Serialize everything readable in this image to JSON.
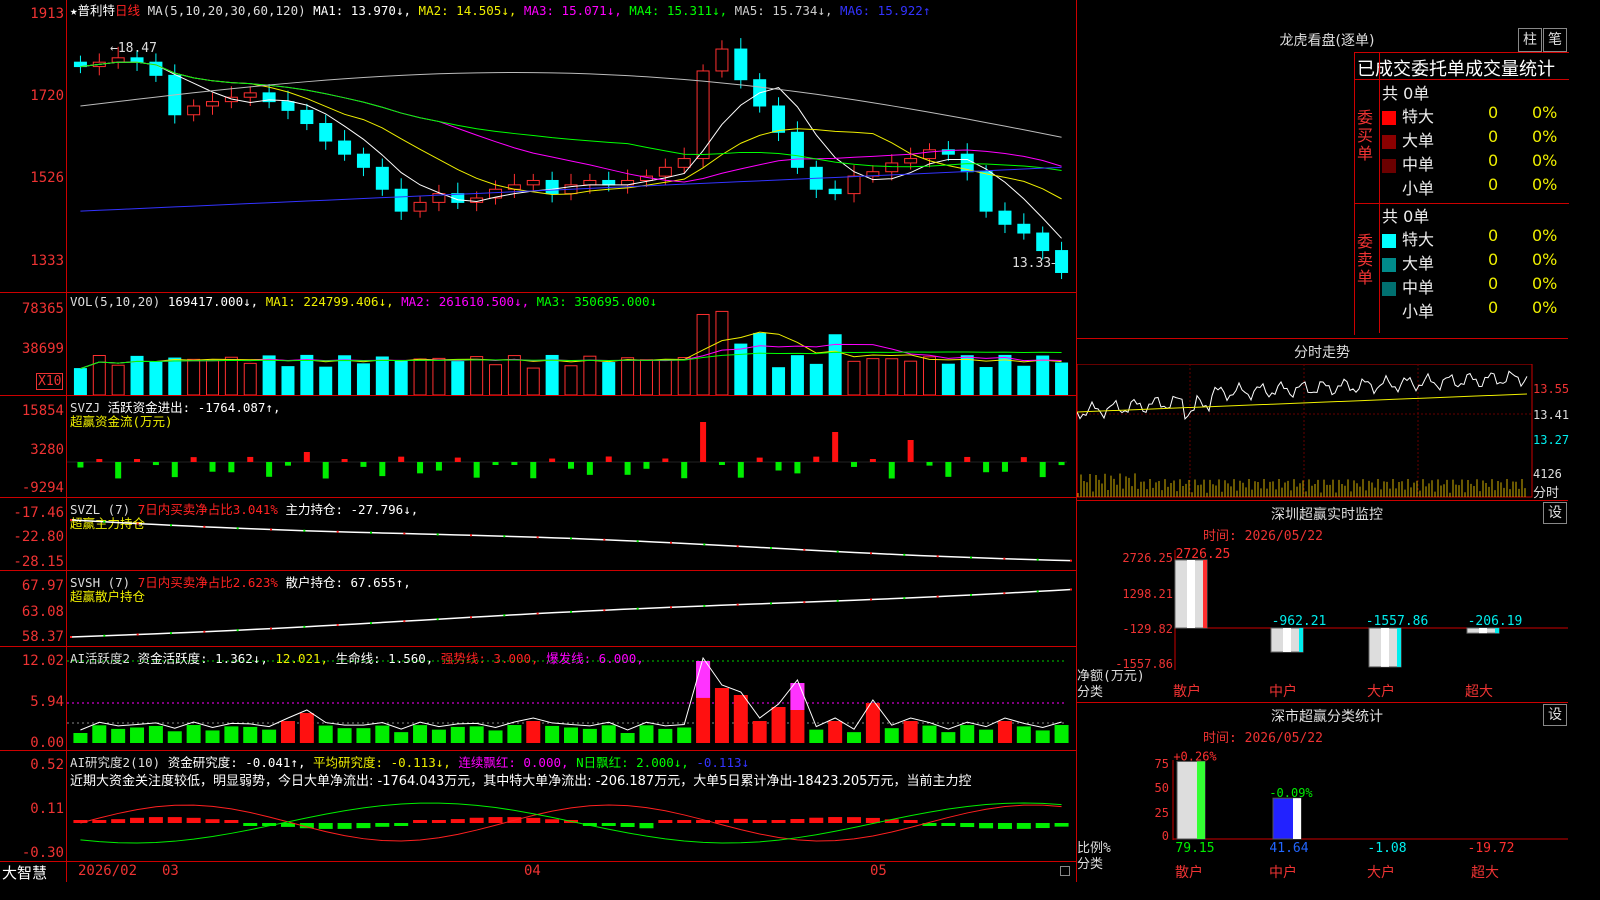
{
  "app": {
    "name": "大智慧"
  },
  "chart_header": {
    "star": "★",
    "stock": "普利特",
    "period": "日线",
    "ma_def": "MA(5,10,20,30,60,120)",
    "ma1": "MA1: 13.970↓,",
    "ma2": "MA2: 14.505↓,",
    "ma3": "MA3: 15.071↓,",
    "ma4": "MA4: 15.311↓,",
    "ma5": "MA5: 15.734↓,",
    "ma6": "MA6: 15.922↑"
  },
  "price_axis": [
    "1913",
    "1720",
    "1526",
    "1333"
  ],
  "price_annotations": {
    "high": "←18.47",
    "low": "13.33→"
  },
  "vol_header": {
    "def": "VOL(5,10,20)",
    "vol": "169417.000↓,",
    "ma1": "MA1: 224799.406↓,",
    "ma2": "MA2: 261610.500↓,",
    "ma3": "MA3: 350695.000↓"
  },
  "vol_axis": [
    "78365",
    "38699"
  ],
  "vol_unit": "X10",
  "svzj_header": {
    "def": "SVZJ",
    "title": "活跃资金进出: -1764.087↑,",
    "sub": "超赢资金流(万元)"
  },
  "svzj_axis": [
    "15854",
    "3280",
    "-9294"
  ],
  "svzl_header": {
    "def": "SVZL (7)",
    "ratio": "7日内买卖净占比3.041%",
    "hold": "主力持仓: -27.796↓,",
    "sub": "超赢主力持仓"
  },
  "svzl_axis": [
    "-17.46",
    "-22.80",
    "-28.15"
  ],
  "svsh_header": {
    "def": "SVSH (7)",
    "ratio": "7日内买卖净占比2.623%",
    "hold": "散户持仓: 67.655↑,",
    "sub": "超赢散户持仓"
  },
  "svsh_axis": [
    "67.97",
    "63.08",
    "58.37"
  ],
  "ai1_header": {
    "def": "AI活跃度2",
    "a": "资金活跃度: 1.362↓,",
    "b": "12.021,",
    "c": "生命线: 1.560,",
    "d": "强势线: 3.000,",
    "e": "爆发线: 6.000,"
  },
  "ai1_axis": [
    "12.02",
    "5.94",
    "0.00"
  ],
  "ai2_header": {
    "def": "AI研究度2(10)",
    "a": "资金研究度: -0.041↑,",
    "b": "平均研究度: -0.113↓,",
    "c": "连续飘红: 0.000,",
    "d": "N日飘红: 2.000↓,",
    "e": "-0.113↓"
  },
  "ai2_comment": "近期大资金关注度较低，明显弱势，今日大单净流出: -1764.043万元，其中特大单净流出: -206.187万元，大单5日累计净出-18423.205万元，当前主力控",
  "ai2_axis": [
    "0.52",
    "0.11",
    "-0.30"
  ],
  "date_axis": [
    "2026/02",
    "03",
    "04",
    "05"
  ],
  "right": {
    "lhkp_title": "龙虎看盘(逐单)",
    "btn_bar": "柱",
    "btn_pen": "笔",
    "stat_title": "已成交委托单成交量统计",
    "buy_label": "委买单",
    "sell_label": "委卖单",
    "buy_total": "共 0单",
    "sell_total": "共 0单",
    "buy_rows": [
      {
        "name": "特大",
        "count": "0",
        "pct": "0%"
      },
      {
        "name": "大单",
        "count": "0",
        "pct": "0%"
      },
      {
        "name": "中单",
        "count": "0",
        "pct": "0%"
      },
      {
        "name": "小单",
        "count": "0",
        "pct": "0%"
      }
    ],
    "sell_rows": [
      {
        "name": "特大",
        "count": "0",
        "pct": "0%"
      },
      {
        "name": "大单",
        "count": "0",
        "pct": "0%"
      },
      {
        "name": "中单",
        "count": "0",
        "pct": "0%"
      },
      {
        "name": "小单",
        "count": "0",
        "pct": "0%"
      }
    ],
    "colors": {
      "buy": [
        "#ff0000",
        "#8b0000",
        "#6b0000"
      ],
      "sell": [
        "#00ffff",
        "#008b8b",
        "#007070"
      ]
    },
    "fs_title": "分时走势",
    "fs_axis": [
      "13.55",
      "13.41",
      "13.27",
      "4126",
      "分时"
    ],
    "sz_monitor_title": "深圳超赢实时监控",
    "set_label": "设",
    "sz_time": "时间: 2026/05/22",
    "sz_axis": [
      "2726.25",
      "1298.21",
      "-129.82",
      "-1557.86"
    ],
    "sz_bar_labels": [
      "2726.25",
      "-962.21",
      "-1557.86",
      "-206.19"
    ],
    "sz_unit": "净额(万元)",
    "sz_fenlei": "分类",
    "cats": [
      "散户",
      "中户",
      "大户",
      "超大"
    ],
    "fl_title": "深市超赢分类统计",
    "fl_time": "时间: 2026/05/22",
    "fl_axis": [
      "75",
      "50",
      "25",
      "0"
    ],
    "fl_top_labels": [
      "+0.26%",
      "-0.09%"
    ],
    "fl_bottom_values": [
      "79.15",
      "41.64",
      "-1.08",
      "-19.72"
    ],
    "fl_unit": "比例%",
    "fl_fenlei": "分类"
  },
  "chart_data": {
    "type": "candlestick",
    "title": "普利特 日线",
    "ylim": [
      13.33,
      19.13
    ],
    "close_series": [
      18.1,
      18.2,
      18.3,
      18.2,
      17.9,
      17.0,
      17.2,
      17.3,
      17.4,
      17.5,
      17.3,
      17.1,
      16.8,
      16.4,
      16.1,
      15.8,
      15.3,
      14.8,
      15.0,
      15.2,
      15.0,
      15.1,
      15.3,
      15.4,
      15.5,
      15.2,
      15.4,
      15.5,
      15.4,
      15.5,
      15.6,
      15.8,
      16.0,
      18.0,
      18.5,
      17.8,
      17.2,
      16.6,
      15.8,
      15.3,
      15.2,
      15.6,
      15.7,
      15.9,
      16.0,
      16.2,
      16.1,
      15.7,
      14.8,
      14.5,
      14.3,
      13.9,
      13.4
    ]
  }
}
